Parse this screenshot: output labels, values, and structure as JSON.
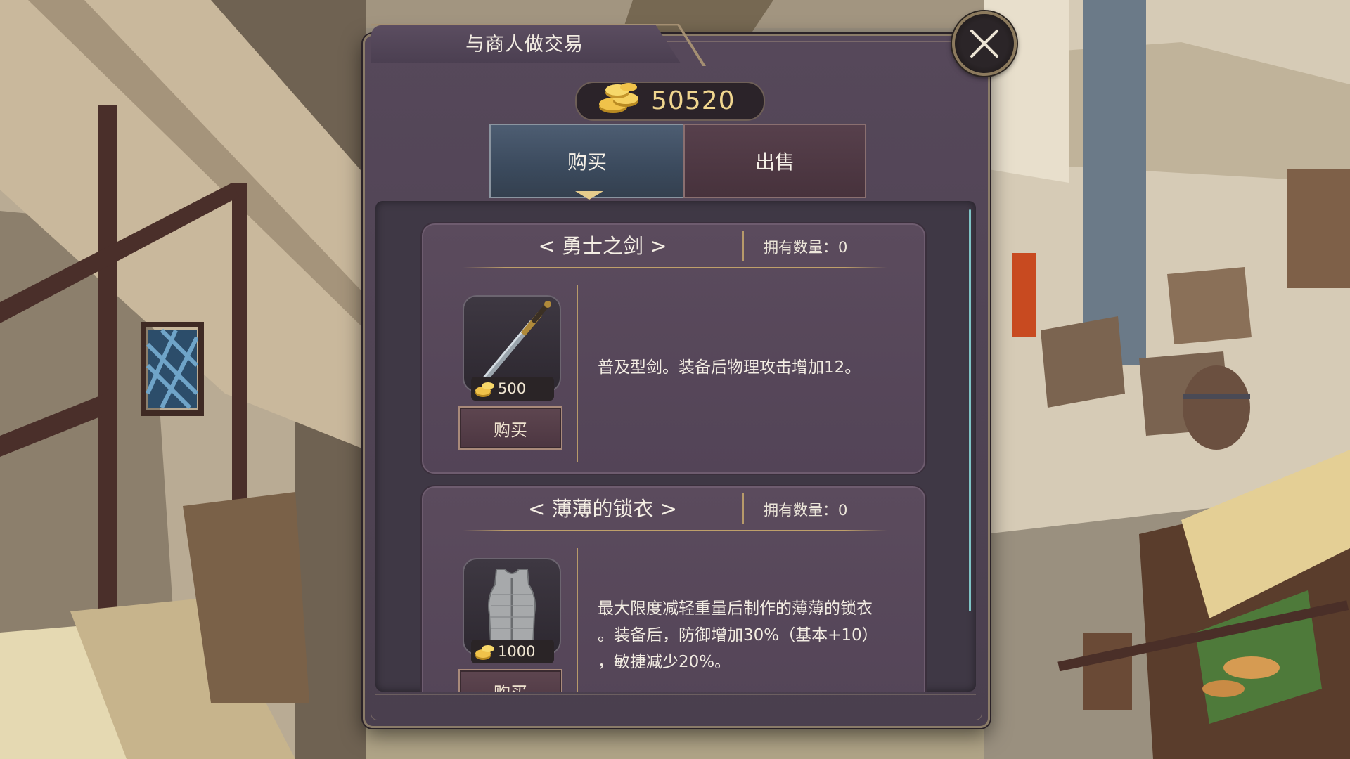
{
  "dialog": {
    "title": "与商人做交易",
    "close_icon": "close-x-icon"
  },
  "wallet": {
    "icon": "gold-coins-icon",
    "amount": "50520"
  },
  "tabs": {
    "buy_label": "购买",
    "sell_label": "出售",
    "active": "buy"
  },
  "items": [
    {
      "name": "< 勇士之剑 >",
      "owned_label": "拥有数量：",
      "owned_value": "0",
      "icon": "sword-icon",
      "price": "500",
      "buy_label": "购买",
      "description": [
        "普及型剑。装备后物理攻击增加12。"
      ]
    },
    {
      "name": "< 薄薄的锁衣 >",
      "owned_label": "拥有数量：",
      "owned_value": "0",
      "icon": "chainmail-armor-icon",
      "price": "1000",
      "buy_label": "购买",
      "description": [
        "最大限度减轻重量后制作的薄薄的锁衣",
        "。装备后，防御增加30%（基本+10）",
        "，敏捷减少20%。"
      ]
    }
  ],
  "colors": {
    "panel": "#4f4354",
    "gold_text": "#f0d68f",
    "buy_tab": "#43536a",
    "sell_tab": "#4f3843",
    "scrollbar": "#7fc4c6"
  }
}
